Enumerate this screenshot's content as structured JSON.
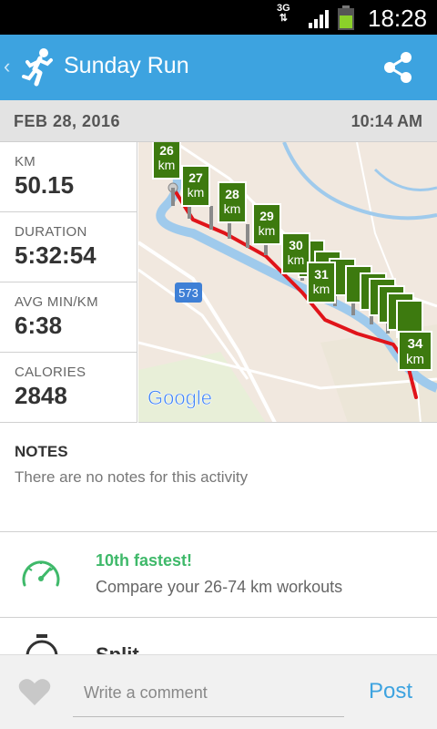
{
  "status_bar": {
    "network": "3G",
    "time": "18:28"
  },
  "app_bar": {
    "title": "Sunday Run"
  },
  "activity": {
    "date": "FEB 28, 2016",
    "time": "10:14 AM"
  },
  "stats": [
    {
      "label": "KM",
      "value": "50.15"
    },
    {
      "label": "DURATION",
      "value": "5:32:54"
    },
    {
      "label": "AVG MIN/KM",
      "value": "6:38"
    },
    {
      "label": "CALORIES",
      "value": "2848"
    }
  ],
  "map": {
    "road_label": "573",
    "google_label": "Google",
    "markers": [
      {
        "num": "26",
        "unit": "km"
      },
      {
        "num": "27",
        "unit": "km"
      },
      {
        "num": "28",
        "unit": "km"
      },
      {
        "num": "29",
        "unit": "km"
      },
      {
        "num": "30",
        "unit": "km"
      },
      {
        "num": "31",
        "unit": "km"
      },
      {
        "num": "34",
        "unit": "km"
      }
    ]
  },
  "notes": {
    "heading": "NOTES",
    "text": "There are no notes for this activity"
  },
  "achievement": {
    "title": "10th fastest!",
    "subtitle": "Compare your 26-74 km workouts"
  },
  "next_section": {
    "title": "Split"
  },
  "comment_bar": {
    "placeholder": "Write a comment",
    "post_label": "Post"
  },
  "colors": {
    "brand": "#3da3e0",
    "achievement": "#3fb96a",
    "route": "#e0141a",
    "marker": "#3d7a0f"
  }
}
